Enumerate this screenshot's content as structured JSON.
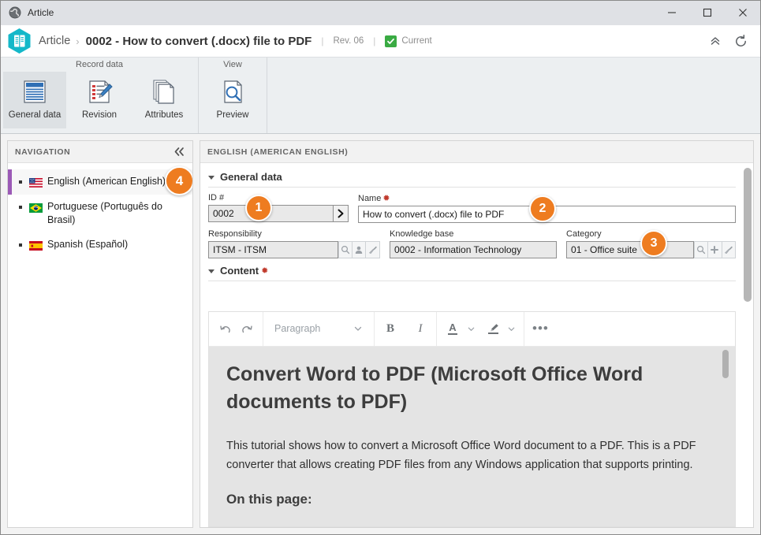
{
  "window": {
    "title": "Article",
    "icon": "globe-icon",
    "controls": {
      "minimize": "—",
      "maximize": "□",
      "close": "✕"
    }
  },
  "header": {
    "breadcrumb_root": "Article",
    "breadcrumb_separator": "›",
    "breadcrumb_title": "0002 - How to convert (.docx) file to PDF",
    "divider": "|",
    "revision": "Rev. 06",
    "status": "Current",
    "collapse_icon": "chevron-double-up-icon",
    "refresh_icon": "refresh-icon"
  },
  "ribbon": {
    "groups": [
      {
        "label": "Record data",
        "items": [
          {
            "label": "General data",
            "icon": "general-data-icon",
            "active": true
          },
          {
            "label": "Revision",
            "icon": "revision-icon",
            "active": false
          },
          {
            "label": "Attributes",
            "icon": "attributes-icon",
            "active": false
          }
        ]
      },
      {
        "label": "View",
        "items": [
          {
            "label": "Preview",
            "icon": "preview-icon",
            "active": false
          }
        ]
      }
    ]
  },
  "navigation": {
    "title": "NAVIGATION",
    "collapse_icon": "chevron-double-left-icon",
    "items": [
      {
        "label": "English (American English)",
        "flag": "flag-us",
        "selected": true,
        "badge": "4"
      },
      {
        "label": "Portuguese (Português do Brasil)",
        "flag": "flag-br",
        "selected": false
      },
      {
        "label": "Spanish (Español)",
        "flag": "flag-es",
        "selected": false
      }
    ]
  },
  "content": {
    "header_title": "ENGLISH (AMERICAN ENGLISH)",
    "sections": {
      "general": {
        "title": "General data",
        "fields": {
          "id": {
            "label": "ID #",
            "value": "0002",
            "badge": "1",
            "arrow_icon": "chevron-right-icon"
          },
          "name": {
            "label": "Name",
            "required": "✹",
            "value": "How to convert (.docx) file to PDF",
            "badge": "2"
          },
          "responsibility": {
            "label": "Responsibility",
            "value": "ITSM - ITSM",
            "buttons": [
              "search-icon",
              "person-icon",
              "clear-icon"
            ]
          },
          "knowledge_base": {
            "label": "Knowledge base",
            "value": "0002 - Information Technology"
          },
          "category": {
            "label": "Category",
            "value": "01 - Office suite",
            "badge": "3",
            "buttons": [
              "search-icon",
              "plus-icon",
              "clear-icon"
            ]
          }
        }
      },
      "content_section": {
        "title": "Content",
        "required": "✹"
      }
    },
    "editor": {
      "toolbar": {
        "undo": "undo-icon",
        "redo": "redo-icon",
        "paragraph_style": "Paragraph",
        "bold": "B",
        "italic": "I",
        "text_color": "A",
        "highlight": "highlighter-icon",
        "more": "•••"
      },
      "document": {
        "heading": "Convert Word to PDF (Microsoft Office Word documents to PDF)",
        "paragraph": "This tutorial shows how to convert a Microsoft Office Word document to a PDF. This is a PDF converter that allows creating PDF files from any Windows application that supports printing.",
        "subheading": "On this page:"
      }
    }
  },
  "colors": {
    "badge_orange": "#ee7c20",
    "accent_purple": "#9b59b6",
    "status_green": "#3aab43",
    "hex_teal": "#14b8c9",
    "required_red": "#c0392b"
  }
}
